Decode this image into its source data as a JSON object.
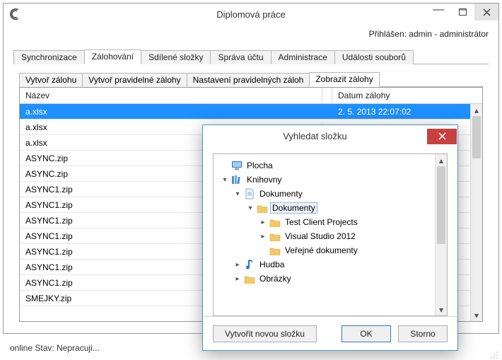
{
  "window": {
    "title": "Diplomová práce",
    "login_label": "Přihlášen: admin - administrátor"
  },
  "main_tabs": [
    {
      "label": "Synchronizace",
      "active": false
    },
    {
      "label": "Zálohování",
      "active": true
    },
    {
      "label": "Sdílené složky",
      "active": false
    },
    {
      "label": "Správa účtu",
      "active": false
    },
    {
      "label": "Administrace",
      "active": false
    },
    {
      "label": "Události souborů",
      "active": false
    }
  ],
  "sub_tabs": [
    {
      "label": "Vytvoř zálohu",
      "active": false
    },
    {
      "label": "Vytvoř pravidelné zálohy",
      "active": false
    },
    {
      "label": "Nastavení pravidelných záloh",
      "active": false
    },
    {
      "label": "Zobrazit zálohy",
      "active": true
    }
  ],
  "table": {
    "columns": {
      "name": "Název",
      "date": "Datum zálohy"
    },
    "rows": [
      {
        "name": "a.xlsx",
        "date": "2. 5. 2013 22:07:02",
        "selected": true
      },
      {
        "name": "a.xlsx",
        "date": "",
        "selected": false
      },
      {
        "name": "a.xlsx",
        "date": "",
        "selected": false
      },
      {
        "name": "ASYNC.zip",
        "date": "",
        "selected": false
      },
      {
        "name": "ASYNC.zip",
        "date": "",
        "selected": false
      },
      {
        "name": "ASYNC1.zip",
        "date": "",
        "selected": false
      },
      {
        "name": "ASYNC1.zip",
        "date": "",
        "selected": false
      },
      {
        "name": "ASYNC1.zip",
        "date": "",
        "selected": false
      },
      {
        "name": "ASYNC1.zip",
        "date": "",
        "selected": false
      },
      {
        "name": "ASYNC1.zip",
        "date": "",
        "selected": false
      },
      {
        "name": "ASYNC1.zip",
        "date": "",
        "selected": false
      },
      {
        "name": "ASYNC1.zip",
        "date": "",
        "selected": false
      },
      {
        "name": "SMEJKY.zip",
        "date": "",
        "selected": false
      }
    ]
  },
  "statusbar": {
    "text": "online  Stav: Nepracuji..."
  },
  "dialog": {
    "title": "Vyhledat složku",
    "tree": [
      {
        "depth": 0,
        "twisty": "",
        "icon": "desktop",
        "label": "Plocha",
        "selected": false
      },
      {
        "depth": 0,
        "twisty": "▾",
        "icon": "library",
        "label": "Knihovny",
        "selected": false
      },
      {
        "depth": 1,
        "twisty": "▾",
        "icon": "doc",
        "label": "Dokumenty",
        "selected": false
      },
      {
        "depth": 2,
        "twisty": "▾",
        "icon": "folder",
        "label": "Dokumenty",
        "selected": true
      },
      {
        "depth": 3,
        "twisty": "▸",
        "icon": "folder",
        "label": "Test Client Projects",
        "selected": false
      },
      {
        "depth": 3,
        "twisty": "▸",
        "icon": "folder",
        "label": "Visual Studio 2012",
        "selected": false
      },
      {
        "depth": 3,
        "twisty": "",
        "icon": "folder",
        "label": "Veřejné dokumenty",
        "selected": false
      },
      {
        "depth": 1,
        "twisty": "▸",
        "icon": "music",
        "label": "Hudba",
        "selected": false
      },
      {
        "depth": 1,
        "twisty": "▸",
        "icon": "folder",
        "label": "Obrázky",
        "selected": false,
        "cut": true
      }
    ],
    "buttons": {
      "new_folder": "Vytvořit novou složku",
      "ok": "OK",
      "cancel": "Storno"
    }
  }
}
